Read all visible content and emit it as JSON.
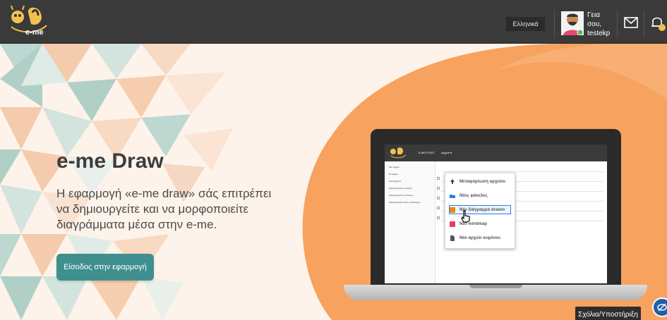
{
  "topbar": {
    "logo_text": "e-me",
    "language": "Ελληνικά",
    "greeting_line1": "Γεια σου,",
    "username": "testekp"
  },
  "hero": {
    "title": "e-me Draw",
    "description": "Η εφαρμογή «e-me draw» σάς επιτρέπει να δημιουργείτε και να μορφοποιείτε διαγράμματα μέσα στην e-me.",
    "enter_button": "Είσοδος στην εφαρμογή"
  },
  "laptop_screen": {
    "nav": [
      "E-ME FILES",
      "Αρχεία ▾"
    ],
    "sidebar": [
      "Νέο αρχείο",
      "Τα αρχεία",
      "Κοινόχρηστα",
      "Διαμοιρασμένα με εμένα",
      "Διαμοιρασμένα με άλλους",
      "Διαμοιρασμένα μέσω συνδέσμων"
    ],
    "menu": [
      {
        "label": "Μεταφόρτωση αρχείου",
        "icon": "upload-icon"
      },
      {
        "label": "Νέος φάκελος",
        "icon": "folder-icon"
      },
      {
        "label": "Νέο διάγραμμα drawio",
        "icon": "drawio-icon"
      },
      {
        "label": "Νέο mindmap",
        "icon": "mindmap-icon"
      },
      {
        "label": "Νέο αρχείο κειμένου",
        "icon": "text-file-icon"
      }
    ]
  },
  "feedback_button": "Σχόλια/Υποστήριξη",
  "colors": {
    "topbar": "#3a3a3a",
    "accent_teal": "#3f8f8f",
    "orange": "#f7a25f",
    "background": "#fdf3ea"
  }
}
